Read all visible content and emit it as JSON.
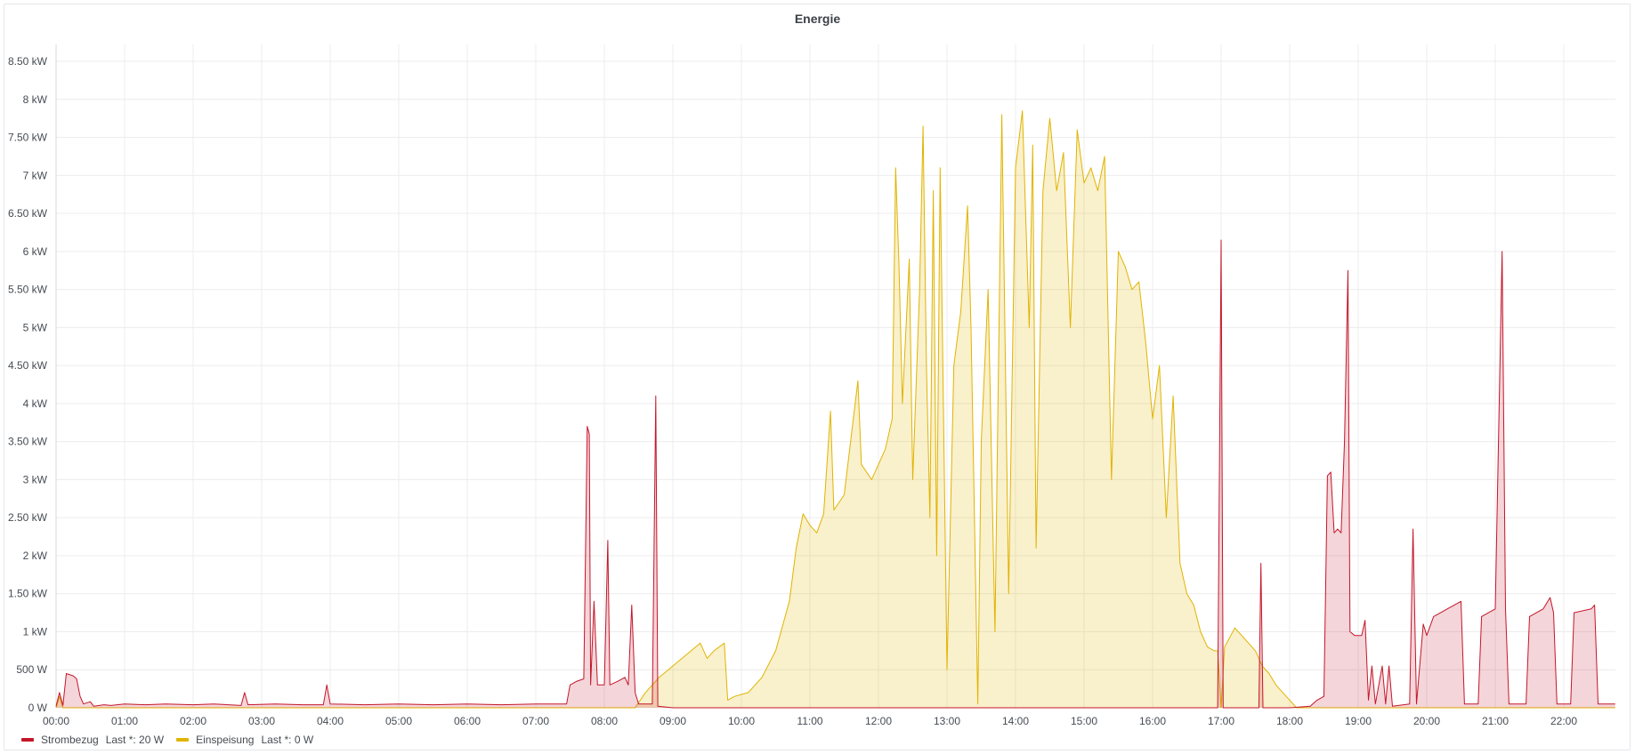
{
  "panel": {
    "title": "Energie"
  },
  "colors": {
    "strombezug": "#c4162a",
    "einspeisung": "#e0b400"
  },
  "legend": [
    {
      "name": "Strombezug",
      "stat": "Last *: 20 W",
      "color": "#c4162a"
    },
    {
      "name": "Einspeisung",
      "stat": "Last *: 0 W",
      "color": "#e0b400"
    }
  ],
  "chart_data": {
    "type": "area",
    "title": "Energie",
    "xlabel": "",
    "ylabel": "",
    "grid": true,
    "legend_position": "bottom-left",
    "x_unit": "hours",
    "xlim": [
      0,
      22.75
    ],
    "ylim": [
      0,
      8.5
    ],
    "x_ticks": [
      "00:00",
      "01:00",
      "02:00",
      "03:00",
      "04:00",
      "05:00",
      "06:00",
      "07:00",
      "08:00",
      "09:00",
      "10:00",
      "11:00",
      "12:00",
      "13:00",
      "14:00",
      "15:00",
      "16:00",
      "17:00",
      "18:00",
      "19:00",
      "20:00",
      "21:00",
      "22:00"
    ],
    "y_ticks": [
      {
        "v": 0,
        "label": "0 W"
      },
      {
        "v": 0.5,
        "label": "500 W"
      },
      {
        "v": 1,
        "label": "1 kW"
      },
      {
        "v": 1.5,
        "label": "1.50 kW"
      },
      {
        "v": 2,
        "label": "2 kW"
      },
      {
        "v": 2.5,
        "label": "2.50 kW"
      },
      {
        "v": 3,
        "label": "3 kW"
      },
      {
        "v": 3.5,
        "label": "3.50 kW"
      },
      {
        "v": 4,
        "label": "4 kW"
      },
      {
        "v": 4.5,
        "label": "4.50 kW"
      },
      {
        "v": 5,
        "label": "5 kW"
      },
      {
        "v": 5.5,
        "label": "5.50 kW"
      },
      {
        "v": 6,
        "label": "6 kW"
      },
      {
        "v": 6.5,
        "label": "6.50 kW"
      },
      {
        "v": 7,
        "label": "7 kW"
      },
      {
        "v": 7.5,
        "label": "7.50 kW"
      },
      {
        "v": 8,
        "label": "8 kW"
      },
      {
        "v": 8.5,
        "label": "8.50 kW"
      }
    ],
    "series": [
      {
        "name": "Strombezug",
        "unit": "kW",
        "points": [
          [
            0,
            0.02
          ],
          [
            0.05,
            0.2
          ],
          [
            0.1,
            0.03
          ],
          [
            0.15,
            0.45
          ],
          [
            0.25,
            0.42
          ],
          [
            0.3,
            0.38
          ],
          [
            0.35,
            0.15
          ],
          [
            0.4,
            0.05
          ],
          [
            0.5,
            0.08
          ],
          [
            0.55,
            0.02
          ],
          [
            0.7,
            0.04
          ],
          [
            0.8,
            0.03
          ],
          [
            1.0,
            0.05
          ],
          [
            1.3,
            0.04
          ],
          [
            1.6,
            0.05
          ],
          [
            2.0,
            0.04
          ],
          [
            2.3,
            0.05
          ],
          [
            2.7,
            0.03
          ],
          [
            2.75,
            0.2
          ],
          [
            2.8,
            0.04
          ],
          [
            3.2,
            0.05
          ],
          [
            3.6,
            0.04
          ],
          [
            3.9,
            0.04
          ],
          [
            3.95,
            0.3
          ],
          [
            4.0,
            0.05
          ],
          [
            4.5,
            0.04
          ],
          [
            5.0,
            0.05
          ],
          [
            5.5,
            0.04
          ],
          [
            6.0,
            0.05
          ],
          [
            6.5,
            0.04
          ],
          [
            7.0,
            0.05
          ],
          [
            7.3,
            0.05
          ],
          [
            7.45,
            0.05
          ],
          [
            7.5,
            0.3
          ],
          [
            7.6,
            0.35
          ],
          [
            7.7,
            0.38
          ],
          [
            7.75,
            3.7
          ],
          [
            7.78,
            3.6
          ],
          [
            7.8,
            0.3
          ],
          [
            7.85,
            1.4
          ],
          [
            7.9,
            0.3
          ],
          [
            8.0,
            0.3
          ],
          [
            8.05,
            2.2
          ],
          [
            8.08,
            0.3
          ],
          [
            8.2,
            0.35
          ],
          [
            8.3,
            0.4
          ],
          [
            8.35,
            0.3
          ],
          [
            8.4,
            1.35
          ],
          [
            8.45,
            0.2
          ],
          [
            8.5,
            0.05
          ],
          [
            8.7,
            0.05
          ],
          [
            8.75,
            4.1
          ],
          [
            8.78,
            0.02
          ],
          [
            9.0,
            0.0
          ],
          [
            12.0,
            0.0
          ],
          [
            15.0,
            0.0
          ],
          [
            16.95,
            0.0
          ],
          [
            17.0,
            6.15
          ],
          [
            17.03,
            0.0
          ],
          [
            17.55,
            0.0
          ],
          [
            17.58,
            1.9
          ],
          [
            17.61,
            0.0
          ],
          [
            18.0,
            0.0
          ],
          [
            18.3,
            0.02
          ],
          [
            18.4,
            0.1
          ],
          [
            18.5,
            0.15
          ],
          [
            18.55,
            3.05
          ],
          [
            18.6,
            3.1
          ],
          [
            18.65,
            2.3
          ],
          [
            18.7,
            2.35
          ],
          [
            18.75,
            2.3
          ],
          [
            18.8,
            3.5
          ],
          [
            18.85,
            5.75
          ],
          [
            18.88,
            1.0
          ],
          [
            18.95,
            0.95
          ],
          [
            19.05,
            0.95
          ],
          [
            19.1,
            1.15
          ],
          [
            19.15,
            0.1
          ],
          [
            19.2,
            0.55
          ],
          [
            19.25,
            0.05
          ],
          [
            19.35,
            0.55
          ],
          [
            19.4,
            0.05
          ],
          [
            19.45,
            0.55
          ],
          [
            19.5,
            0.02
          ],
          [
            19.75,
            0.05
          ],
          [
            19.8,
            2.35
          ],
          [
            19.85,
            0.05
          ],
          [
            19.95,
            1.1
          ],
          [
            20.0,
            0.95
          ],
          [
            20.1,
            1.2
          ],
          [
            20.3,
            1.3
          ],
          [
            20.5,
            1.4
          ],
          [
            20.55,
            0.05
          ],
          [
            20.75,
            0.05
          ],
          [
            20.8,
            1.2
          ],
          [
            21.0,
            1.3
          ],
          [
            21.1,
            6.0
          ],
          [
            21.15,
            1.3
          ],
          [
            21.2,
            0.05
          ],
          [
            21.45,
            0.05
          ],
          [
            21.5,
            1.2
          ],
          [
            21.7,
            1.3
          ],
          [
            21.8,
            1.45
          ],
          [
            21.85,
            1.25
          ],
          [
            21.9,
            0.05
          ],
          [
            22.1,
            0.05
          ],
          [
            22.15,
            1.25
          ],
          [
            22.4,
            1.3
          ],
          [
            22.45,
            1.35
          ],
          [
            22.5,
            0.05
          ],
          [
            22.75,
            0.05
          ]
        ]
      },
      {
        "name": "Einspeisung",
        "unit": "kW",
        "points": [
          [
            0,
            0.0
          ],
          [
            0.05,
            0.15
          ],
          [
            0.1,
            0.0
          ],
          [
            8.45,
            0.0
          ],
          [
            8.6,
            0.2
          ],
          [
            8.8,
            0.4
          ],
          [
            9.0,
            0.55
          ],
          [
            9.2,
            0.7
          ],
          [
            9.4,
            0.85
          ],
          [
            9.5,
            0.65
          ],
          [
            9.6,
            0.75
          ],
          [
            9.75,
            0.85
          ],
          [
            9.8,
            0.1
          ],
          [
            9.9,
            0.15
          ],
          [
            10.1,
            0.2
          ],
          [
            10.3,
            0.4
          ],
          [
            10.5,
            0.75
          ],
          [
            10.7,
            1.4
          ],
          [
            10.8,
            2.1
          ],
          [
            10.9,
            2.55
          ],
          [
            11.0,
            2.4
          ],
          [
            11.1,
            2.3
          ],
          [
            11.2,
            2.55
          ],
          [
            11.3,
            3.9
          ],
          [
            11.35,
            2.6
          ],
          [
            11.5,
            2.8
          ],
          [
            11.7,
            4.3
          ],
          [
            11.75,
            3.2
          ],
          [
            11.9,
            3.0
          ],
          [
            12.1,
            3.4
          ],
          [
            12.2,
            3.8
          ],
          [
            12.25,
            7.1
          ],
          [
            12.3,
            5.8
          ],
          [
            12.35,
            4.0
          ],
          [
            12.45,
            5.9
          ],
          [
            12.5,
            3.0
          ],
          [
            12.6,
            5.5
          ],
          [
            12.65,
            7.65
          ],
          [
            12.7,
            4.5
          ],
          [
            12.75,
            2.5
          ],
          [
            12.8,
            6.8
          ],
          [
            12.85,
            2.0
          ],
          [
            12.9,
            7.1
          ],
          [
            13.0,
            0.5
          ],
          [
            13.1,
            4.5
          ],
          [
            13.2,
            5.2
          ],
          [
            13.3,
            6.6
          ],
          [
            13.35,
            5.0
          ],
          [
            13.45,
            0.05
          ],
          [
            13.5,
            3.5
          ],
          [
            13.6,
            5.5
          ],
          [
            13.7,
            1.0
          ],
          [
            13.8,
            7.8
          ],
          [
            13.9,
            1.5
          ],
          [
            14.0,
            7.1
          ],
          [
            14.1,
            7.85
          ],
          [
            14.2,
            5.0
          ],
          [
            14.25,
            7.4
          ],
          [
            14.3,
            2.1
          ],
          [
            14.4,
            6.8
          ],
          [
            14.5,
            7.75
          ],
          [
            14.6,
            6.8
          ],
          [
            14.7,
            7.3
          ],
          [
            14.8,
            5.0
          ],
          [
            14.9,
            7.6
          ],
          [
            15.0,
            6.9
          ],
          [
            15.1,
            7.1
          ],
          [
            15.2,
            6.8
          ],
          [
            15.3,
            7.25
          ],
          [
            15.4,
            3.0
          ],
          [
            15.5,
            6.0
          ],
          [
            15.6,
            5.8
          ],
          [
            15.7,
            5.5
          ],
          [
            15.8,
            5.6
          ],
          [
            15.9,
            4.8
          ],
          [
            16.0,
            3.8
          ],
          [
            16.1,
            4.5
          ],
          [
            16.2,
            2.5
          ],
          [
            16.3,
            4.1
          ],
          [
            16.4,
            1.9
          ],
          [
            16.5,
            1.5
          ],
          [
            16.6,
            1.35
          ],
          [
            16.7,
            1.0
          ],
          [
            16.8,
            0.8
          ],
          [
            16.9,
            0.75
          ],
          [
            16.95,
            0.75
          ],
          [
            17.0,
            0.0
          ],
          [
            17.05,
            0.8
          ],
          [
            17.2,
            1.05
          ],
          [
            17.3,
            0.95
          ],
          [
            17.4,
            0.85
          ],
          [
            17.5,
            0.75
          ],
          [
            17.6,
            0.55
          ],
          [
            17.7,
            0.45
          ],
          [
            17.8,
            0.3
          ],
          [
            17.9,
            0.2
          ],
          [
            18.0,
            0.1
          ],
          [
            18.1,
            0.0
          ],
          [
            22.75,
            0.0
          ]
        ]
      }
    ]
  }
}
